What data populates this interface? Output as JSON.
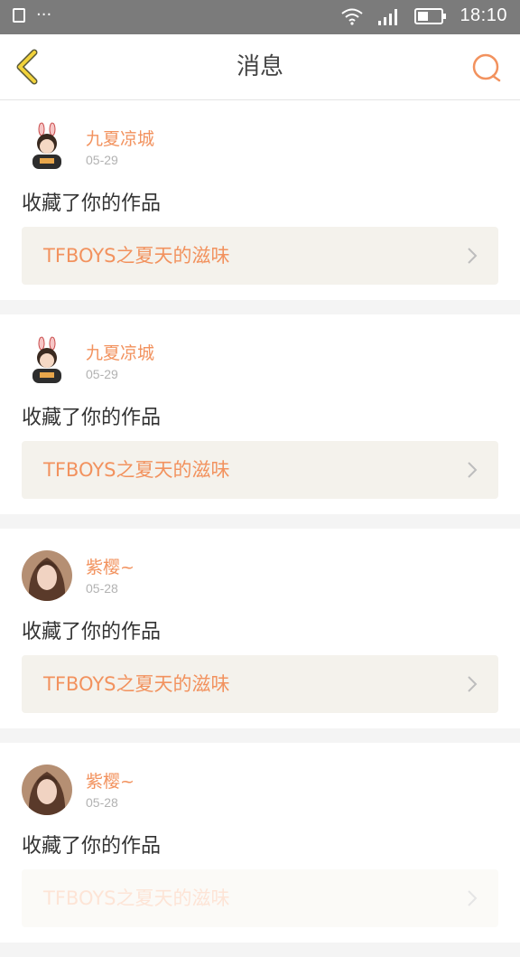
{
  "status_bar": {
    "time": "18:10",
    "dots": "···"
  },
  "header": {
    "title": "消息"
  },
  "colors": {
    "accent": "#f2925e",
    "back_icon": "#f1d23b"
  },
  "messages": [
    {
      "user": "九夏凉城",
      "date": "05-29",
      "action": "收藏了你的作品",
      "work": "TFBOYS之夏天的滋味"
    },
    {
      "user": "九夏凉城",
      "date": "05-29",
      "action": "收藏了你的作品",
      "work": "TFBOYS之夏天的滋味"
    },
    {
      "user": "紫樱~",
      "date": "05-28",
      "action": "收藏了你的作品",
      "work": "TFBOYS之夏天的滋味"
    },
    {
      "user": "紫樱~",
      "date": "05-28",
      "action": "收藏了你的作品",
      "work": "TFBOYS之夏天的滋味"
    }
  ]
}
